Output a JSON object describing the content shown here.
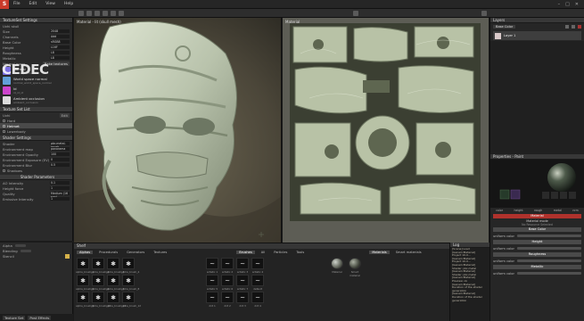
{
  "menubar": {
    "items": [
      "File",
      "Edit",
      "View",
      "Help"
    ],
    "window_controls": [
      "–",
      "□",
      "✕"
    ]
  },
  "left_panel": {
    "header": "TextureSet Settings",
    "title_row": "Uvhi skull",
    "params": [
      {
        "label": "Size",
        "value": "2048"
      },
      {
        "label": "Channels",
        "value": "Add"
      },
      {
        "label": "Base Color",
        "value": "sRGB8"
      },
      {
        "label": "Height",
        "value": "L16F"
      },
      {
        "label": "Roughness",
        "value": "L8"
      },
      {
        "label": "Metallic",
        "value": "L8"
      }
    ],
    "normal_maps_label": "Normal maps",
    "bake_textures_button": "Bake textures",
    "map_slots": [
      {
        "name": "Normal",
        "sub": "normal_normal",
        "color": "#7b6fe0"
      },
      {
        "name": "World space normal",
        "sub": "normal_world_space_normal",
        "color": "#62a0d8"
      },
      {
        "name": "Id",
        "sub": "id_id_id",
        "color": "#cc44cc"
      },
      {
        "name": "Ambient occlusion",
        "sub": "ambient_occlusion",
        "color": "#dddddd"
      }
    ],
    "section2_header": "Texture Set List",
    "section2_rows": [
      "Uvhi",
      "Hard",
      "Helmet",
      "Lowerbody"
    ],
    "section2_active": "Helmet",
    "shader_header": "Shader Settings",
    "shader_rows": [
      "Shader",
      "Environment map",
      "Environment Opacity",
      "Environment Exposure (EV)",
      "Environment Blur",
      "Shadows"
    ],
    "shader_values": [
      "pbr-metal-rough",
      "panorama",
      "100",
      "0",
      "0.5",
      ""
    ],
    "params_header": "Shader Parameters",
    "params_rows": [
      "AO Intensity",
      "Height force",
      "Quality",
      "Emissive Intensity"
    ],
    "params_values": [
      "0.1",
      "1",
      "Medium (16 spp)",
      "1"
    ]
  },
  "viewport3d": {
    "label": "Material - lit (skull mesh)"
  },
  "viewport2d": {
    "label": "Material"
  },
  "right_panel": {
    "layers_header": "Layers",
    "layer_tab": "Base Color",
    "layer_name": "Layer 1",
    "properties_header": "Properties - Paint",
    "material_header": "Material",
    "material_mode": "Material mode",
    "no_resource": "No Resource Selected",
    "channels": [
      "color",
      "height",
      "rough",
      "metal",
      "nrm"
    ],
    "sections": [
      {
        "title": "Base Color",
        "value": "uniform color"
      },
      {
        "title": "Height",
        "value": "uniform color"
      },
      {
        "title": "Roughness",
        "value": "uniform color"
      },
      {
        "title": "Metallic",
        "value": "uniform color"
      }
    ]
  },
  "shelf": {
    "title": "Shelf",
    "tabs_left": [
      "Alphas",
      "Procedurals",
      "Generators",
      "Textures"
    ],
    "tabs_mid": [
      "Brushes",
      "All",
      "Particles",
      "Tools"
    ],
    "tabs_right": [
      "Materials",
      "Smart materials"
    ],
    "alpha_names": [
      "alpha_brush_1",
      "alpha_brush_2",
      "alpha_brush_3",
      "alpha_brush_4",
      "alpha_brush_5",
      "alpha_brush_6",
      "alpha_brush_7",
      "alpha_brush_8",
      "alpha_brush_9",
      "alpha_brush_10",
      "alpha_brush_11",
      "alpha_brush_12"
    ],
    "brush_names": [
      "artistic 1",
      "artistic 2",
      "artistic 3",
      "artistic 4",
      "artistic 5",
      "artistic 6",
      "artistic 7",
      "default brush",
      "dirt 1",
      "dirt 2",
      "dirt 3",
      "dirt 4"
    ],
    "material_names": [
      "Material",
      "Smart material"
    ]
  },
  "log": {
    "title": "Log",
    "lines": [
      "[Scene] Load",
      "[GenericMaterial]",
      "Project 10.0...",
      "[GenericMaterial]",
      "Project 10.0...",
      "[GenericMaterial]",
      "Shader: pbr-metal",
      "[GenericMaterial]",
      "Shader: pbr-metal",
      "[GenericMaterial]",
      "Preview: ok",
      "[GenericMaterial]",
      "Duration of the shader",
      "generation",
      "[GenericMaterial]",
      "Duration of the shader",
      "generation"
    ]
  },
  "statusbar": {
    "tabs": [
      "Texture Set",
      "Post Effects"
    ]
  },
  "watermark": "CEDEC"
}
